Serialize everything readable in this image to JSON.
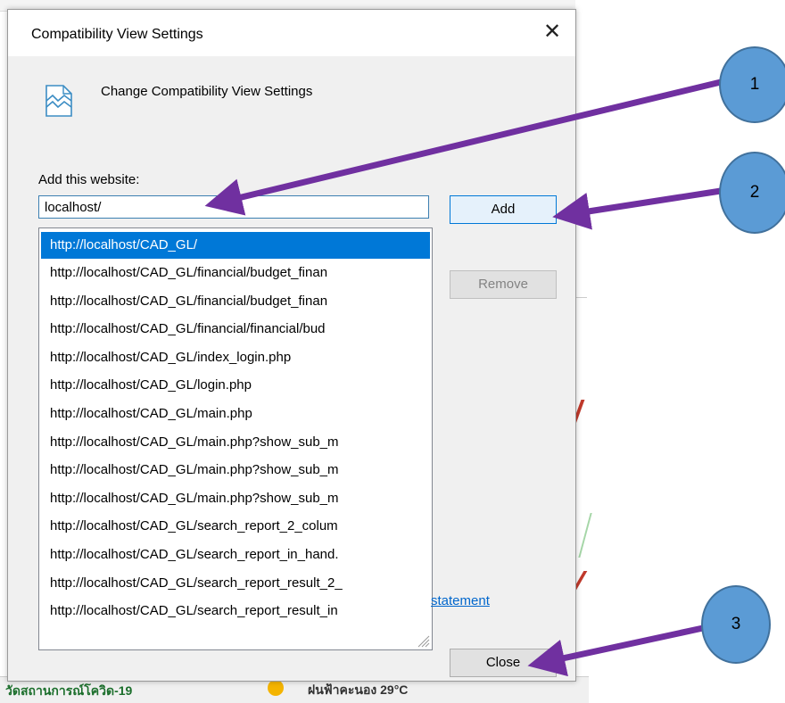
{
  "dialog": {
    "title": "Compatibility View Settings",
    "close_glyph": "✕",
    "header_icon": "compatibility-broken-page-icon",
    "header_text": "Change Compatibility View Settings",
    "add_label": "Add this website:",
    "input_value": "localhost/",
    "add_button": "Add",
    "remove_button": "Remove",
    "close_button": "Close",
    "privacy_link": "statement",
    "sites": [
      "http://localhost/CAD_GL/",
      "http://localhost/CAD_GL/financial/budget_finan",
      "http://localhost/CAD_GL/financial/budget_finan",
      "http://localhost/CAD_GL/financial/financial/bud",
      "http://localhost/CAD_GL/index_login.php",
      "http://localhost/CAD_GL/login.php",
      "http://localhost/CAD_GL/main.php",
      "http://localhost/CAD_GL/main.php?show_sub_m",
      "http://localhost/CAD_GL/main.php?show_sub_m",
      "http://localhost/CAD_GL/main.php?show_sub_m",
      "http://localhost/CAD_GL/search_report_2_colum",
      "http://localhost/CAD_GL/search_report_in_hand.",
      "http://localhost/CAD_GL/search_report_result_2_",
      "http://localhost/CAD_GL/search_report_result_in"
    ],
    "selected_index": 0
  },
  "annotations": {
    "callout_1": "1",
    "callout_2": "2",
    "callout_3": "3",
    "arrow_color": "#7030a0",
    "callout_color": "#5b9bd5"
  },
  "background": {
    "taskbar_text": "วัดสถานการณ์โควิด-19",
    "weather_text": "ฝนฟ้าคะนอง 29°C"
  }
}
